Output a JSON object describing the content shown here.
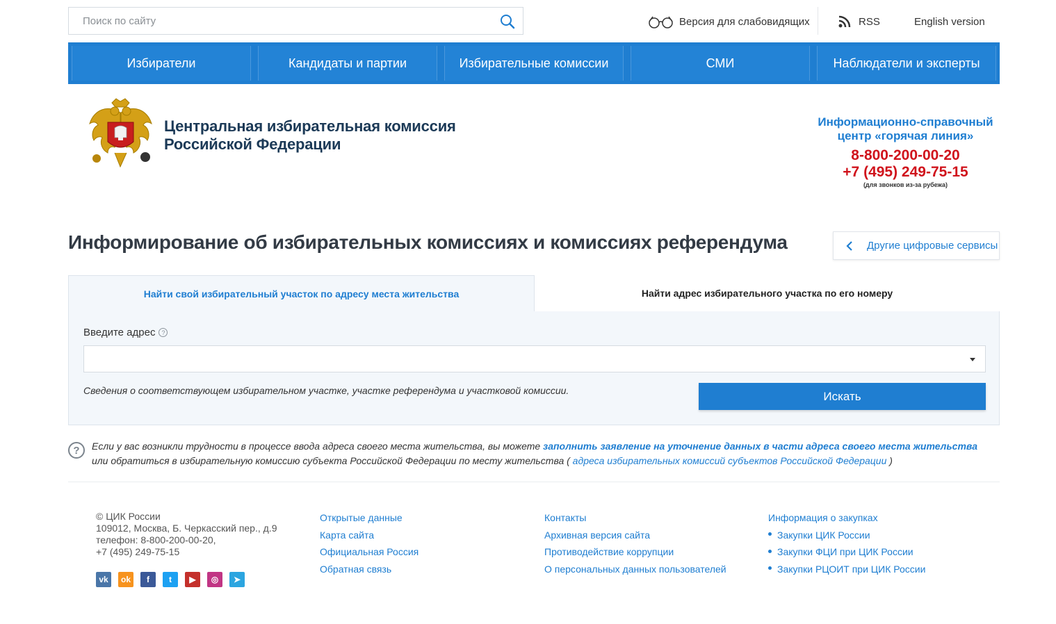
{
  "top": {
    "search_placeholder": "Поиск по сайту",
    "low_vision_label": "Версия для слабовидящих",
    "rss_label": "RSS",
    "english_label": "English version"
  },
  "nav": {
    "items": [
      "Избиратели",
      "Кандидаты и партии",
      "Избирательные комиссии",
      "СМИ",
      "Наблюдатели и эксперты"
    ]
  },
  "header": {
    "org_line1": "Центральная избирательная комиссия",
    "org_line2": "Российской Федерации",
    "hotline_title1": "Информационно-справочный",
    "hotline_title2": "центр «горячая линия»",
    "hotline_phone1": "8-800-200-00-20",
    "hotline_phone2": "+7 (495) 249-75-15",
    "hotline_note": "(для звонков из-за рубежа)"
  },
  "main": {
    "title": "Информирование об избирательных комиссиях и комиссиях референдума",
    "other_services": "Другие цифровые сервисы",
    "tab_active": "Найти свой избирательный участок по адресу места жительства",
    "tab_inactive": "Найти адрес избирательного участка по его номеру",
    "address_label": "Введите адрес",
    "address_value": "",
    "info_text": "Сведения о соответствующем избирательном участке, участке референдума и участковой комиссии.",
    "search_button": "Искать"
  },
  "help": {
    "text1": "Если у вас возникли трудности в процессе ввода адреса своего места жительства, вы можете ",
    "link1": "заполнить заявление на уточнение данных в части адреса своего места жительства",
    "text2": " или обратиться в избирательную комиссию субъекта Российской Федерации по месту жительства ( ",
    "link2": "адреса избирательных комиссий субъектов Российской Федерации",
    "text3": " )"
  },
  "footer": {
    "copyright": "© ЦИК России",
    "address": "109012, Москва, Б. Черкасский пер., д.9",
    "phone1": "телефон: 8-800-200-00-20,",
    "phone2": "+7 (495) 249-75-15",
    "col1": [
      "Открытые данные",
      "Карта сайта",
      "Официальная Россия",
      "Обратная связь"
    ],
    "col2": [
      "Контакты",
      "Архивная версия сайта",
      "Противодействие коррупции",
      "О персональных данных пользователей"
    ],
    "col3_title": "Информация о закупках",
    "col3": [
      "Закупки ЦИК России",
      "Закупки ФЦИ при ЦИК России",
      "Закупки РЦОИТ при ЦИК России"
    ],
    "socials": [
      {
        "icon": "vk-icon",
        "glyph": "vk",
        "color": "#4a76a8"
      },
      {
        "icon": "odnoklassniki-icon",
        "glyph": "ok",
        "color": "#f7931e"
      },
      {
        "icon": "facebook-icon",
        "glyph": "f",
        "color": "#3b5998"
      },
      {
        "icon": "twitter-icon",
        "glyph": "t",
        "color": "#1da1f2"
      },
      {
        "icon": "youtube-icon",
        "glyph": "▶",
        "color": "#c4302b"
      },
      {
        "icon": "instagram-icon",
        "glyph": "◎",
        "color": "#c13584"
      },
      {
        "icon": "telegram-icon",
        "glyph": "➤",
        "color": "#2ca5e0"
      }
    ]
  },
  "colors": {
    "accent": "#1f7ed1",
    "hotline_red": "#d0131c",
    "title_dark": "#333b45"
  }
}
